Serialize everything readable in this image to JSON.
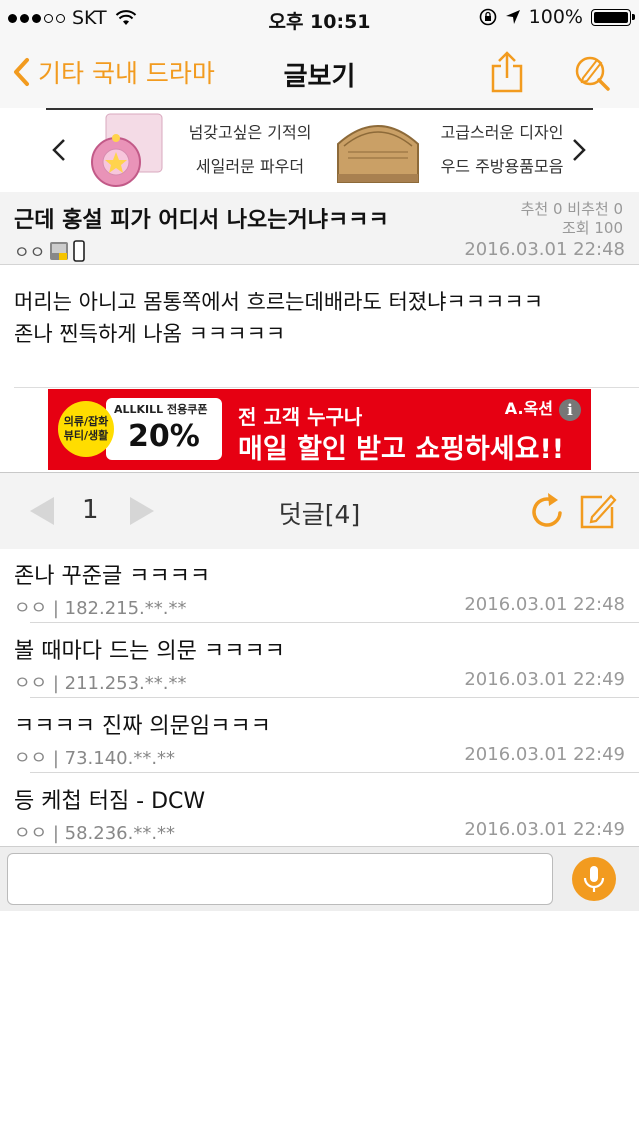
{
  "status_bar": {
    "carrier": "SKT",
    "time": "오후 10:51",
    "battery": "100%"
  },
  "nav": {
    "back_label": "기타 국내 드라마",
    "title": "글보기"
  },
  "banner": {
    "product1_line1": "넘갖고싶은 기적의",
    "product1_line2": "세일러문 파우더",
    "product2_line1": "고급스러운 디자인",
    "product2_line2": "우드 주방용품모음"
  },
  "post": {
    "title": "근데 홍설 피가 어디서 나오는거냐ㅋㅋㅋ",
    "recommend": "추천 0 비추천 0",
    "views": "조회 100",
    "author": "ㅇㅇ",
    "date": "2016.03.01 22:48",
    "body_line1": "머리는 아니고 몸통쪽에서 흐르는데배라도 터졌냐ㅋㅋㅋㅋㅋ",
    "body_line2": "존나 찐득하게 나옴 ㅋㅋㅋㅋㅋ"
  },
  "ad": {
    "badge": "의류/잡화 뷰티/생활",
    "allkill": "ALLKILL 전용쿠폰",
    "percent": "20%",
    "line1": "전 고객 누구나",
    "line2": "매일 할인 받고 쇼핑하세요!!",
    "brand": "A.옥션",
    "info": "i"
  },
  "comments_header": {
    "page": "1",
    "title": "덧글[4]"
  },
  "comments": [
    {
      "text": "존나 꾸준글 ㅋㅋㅋㅋ",
      "author": "ㅇㅇ | 182.215.**.**",
      "date": "2016.03.01 22:48"
    },
    {
      "text": "볼 때마다 드는 의문 ㅋㅋㅋㅋ",
      "author": "ㅇㅇ | 211.253.**.**",
      "date": "2016.03.01 22:49"
    },
    {
      "text": "ㅋㅋㅋㅋ 진짜 의문임ㅋㅋㅋ",
      "author": "ㅇㅇ | 73.140.**.**",
      "date": "2016.03.01 22:49"
    },
    {
      "text": "등 케첩 터짐 - DCW",
      "author": "ㅇㅇ | 58.236.**.**",
      "date": "2016.03.01 22:49"
    }
  ],
  "colors": {
    "accent": "#f29b1f",
    "ad_red": "#e60012"
  }
}
